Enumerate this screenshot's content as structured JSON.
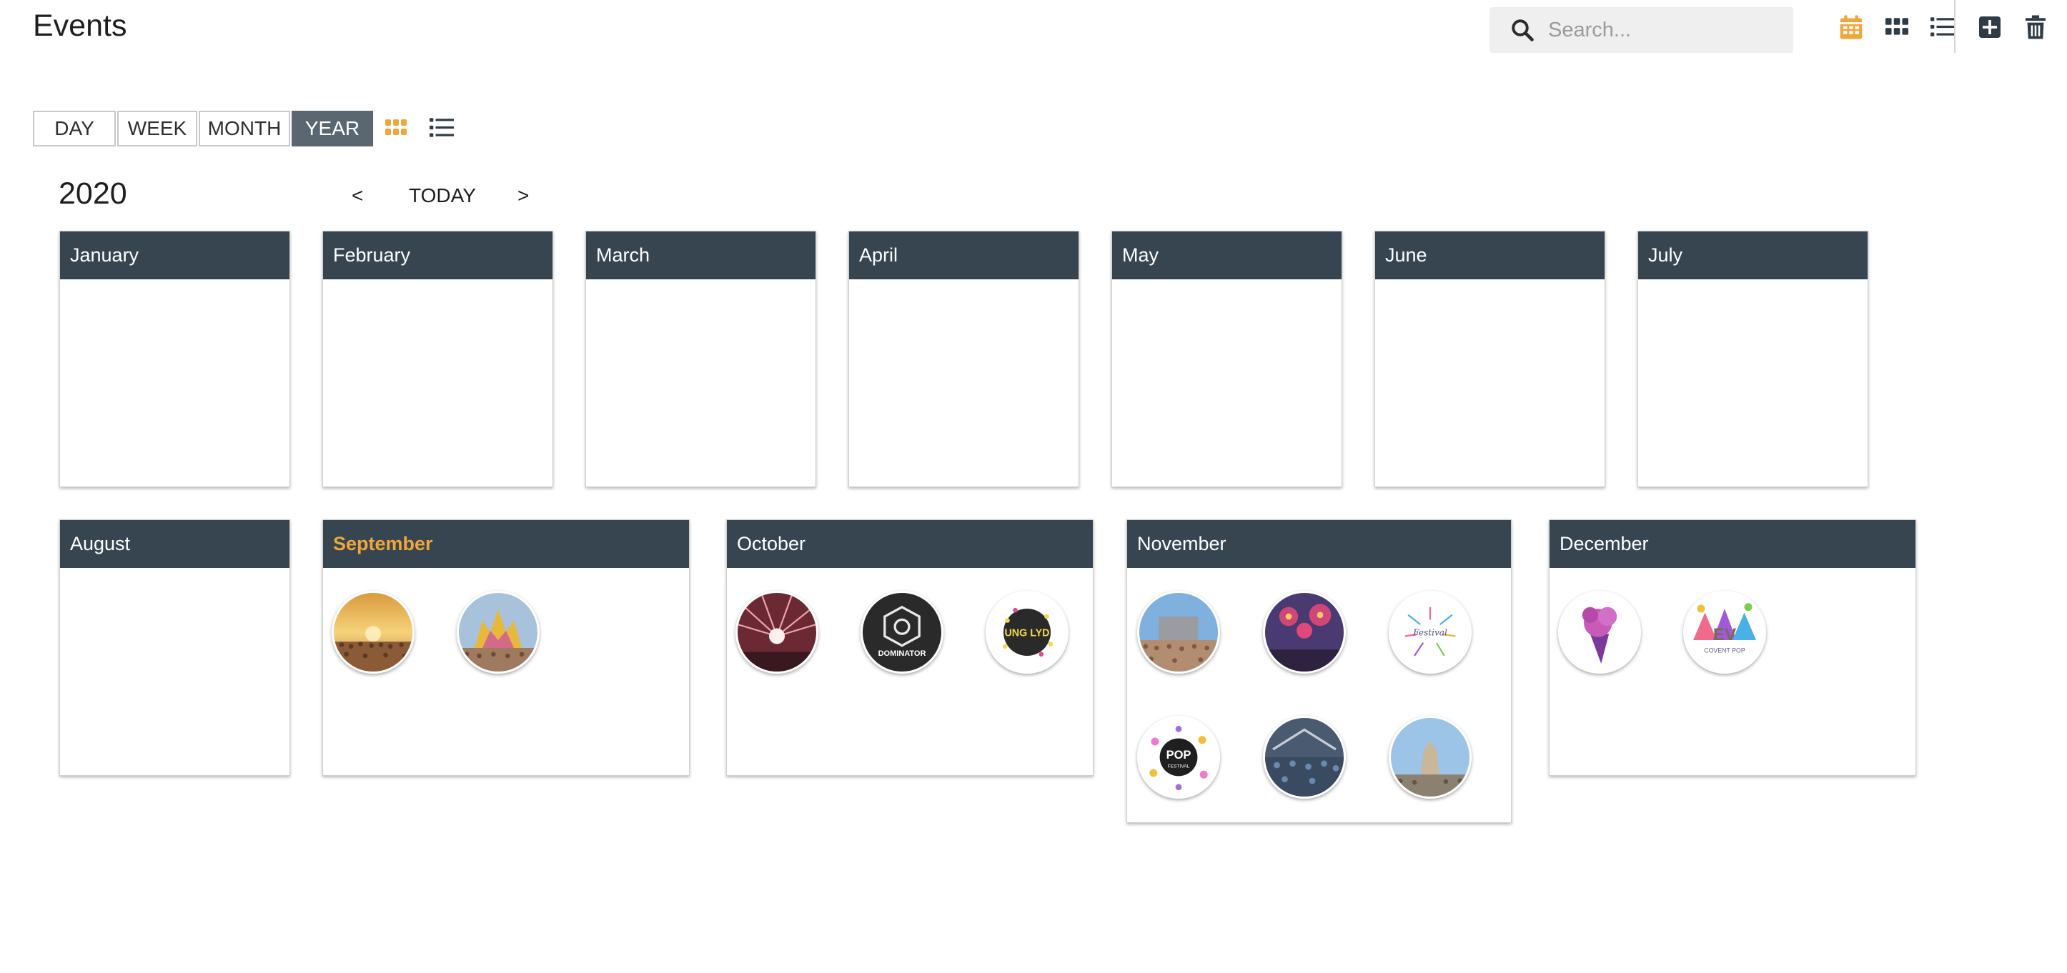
{
  "header": {
    "title": "Events",
    "search_placeholder": "Search...",
    "accent_color": "#f0a63a",
    "icons": [
      "calendar-icon",
      "grid-icon",
      "list-icon",
      "add-icon",
      "trash-icon"
    ]
  },
  "view_switch": {
    "day": "DAY",
    "week": "WEEK",
    "month": "MONTH",
    "year": "YEAR",
    "selected": "YEAR"
  },
  "nav": {
    "year": "2020",
    "prev": "<",
    "today": "TODAY",
    "next": ">"
  },
  "months": [
    {
      "name": "January",
      "events": []
    },
    {
      "name": "February",
      "events": []
    },
    {
      "name": "March",
      "events": []
    },
    {
      "name": "April",
      "events": []
    },
    {
      "name": "May",
      "events": []
    },
    {
      "name": "June",
      "events": []
    },
    {
      "name": "July",
      "events": []
    },
    {
      "name": "August",
      "events": []
    },
    {
      "name": "September",
      "current": true,
      "events": [
        "sunset-crowd",
        "colorful-stage"
      ]
    },
    {
      "name": "October",
      "events": [
        "laser-show",
        "dominator-logo",
        "ung-lyd-logo"
      ]
    },
    {
      "name": "November",
      "events": [
        "daytime-crowd",
        "pink-fireworks",
        "festival-logo",
        "pop-festival-logo",
        "tent-crowd",
        "sky-crowd"
      ]
    },
    {
      "name": "December",
      "events": [
        "purple-icecream-logo",
        "covent-pop-logo"
      ]
    }
  ],
  "logo_texts": {
    "dominator": "DOMINATOR",
    "ung_lyd": "UNG LYD",
    "festival": "Festival",
    "pop": "POP",
    "pop_sub": "FESTIVAL",
    "covent": "COVENT POP",
    "ev": "EV"
  }
}
